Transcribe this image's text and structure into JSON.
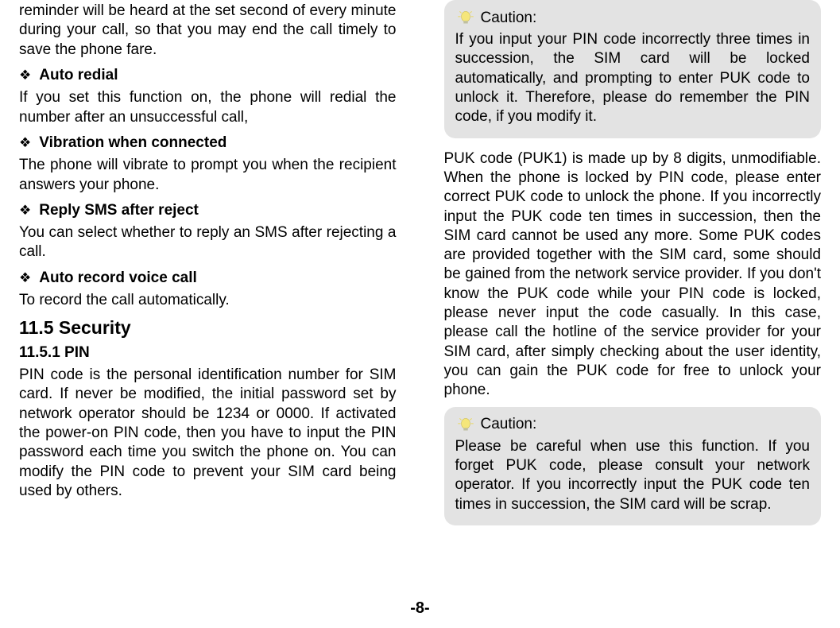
{
  "left": {
    "p1": "reminder will be heard at the set second of every minute during your call, so that you may end the call timely to save the phone fare.",
    "b1": "Auto redial",
    "p2": "If you set this function on, the phone will redial the number after an unsuccessful call,",
    "b2": "Vibration when connected",
    "p3": "The phone will vibrate to prompt you when the recipient answers your phone.",
    "b3": "Reply SMS after reject",
    "p4": "You can select whether to reply an SMS after rejecting a call.",
    "b4": "Auto record voice call",
    "p5": "To record the call automatically.",
    "h2": "11.5 Security",
    "h3": "11.5.1 PIN",
    "p6": "PIN code is the personal identification number for SIM card. If never be modified, the initial password set by network operator should be 1234 or 0000. If activated the power-on PIN code, then you have to input the PIN password each time you switch the phone on. You can modify the PIN code to prevent your SIM card being used by others."
  },
  "right": {
    "caution1_label": "Caution:",
    "caution1_body": "If you input your PIN code incorrectly three times in succession, the SIM card will be locked automatically, and prompting to enter PUK code to unlock it. Therefore, please do remember the PIN code, if you modify it.",
    "p1": "PUK code (PUK1) is made up by 8 digits, unmodifiable. When the phone is locked by PIN code, please enter correct PUK code to unlock the phone. If you incorrectly input the PUK code ten times in succession, then the SIM card cannot be used any more. Some PUK codes are provided together with the SIM card, some should be gained from the network service provider. If you don't know the PUK code while your PIN code is locked, please never input the code casually. In this case, please call the hotline of the service provider for your SIM card, after simply checking about the user identity, you can gain the PUK code for free to unlock your phone.",
    "caution2_label": "Caution:",
    "caution2_body": "Please be careful when use this function. If you forget PUK code, please consult your network operator. If you incorrectly input the PUK code ten times in succession, the SIM card will be scrap."
  },
  "footer": "-8-"
}
